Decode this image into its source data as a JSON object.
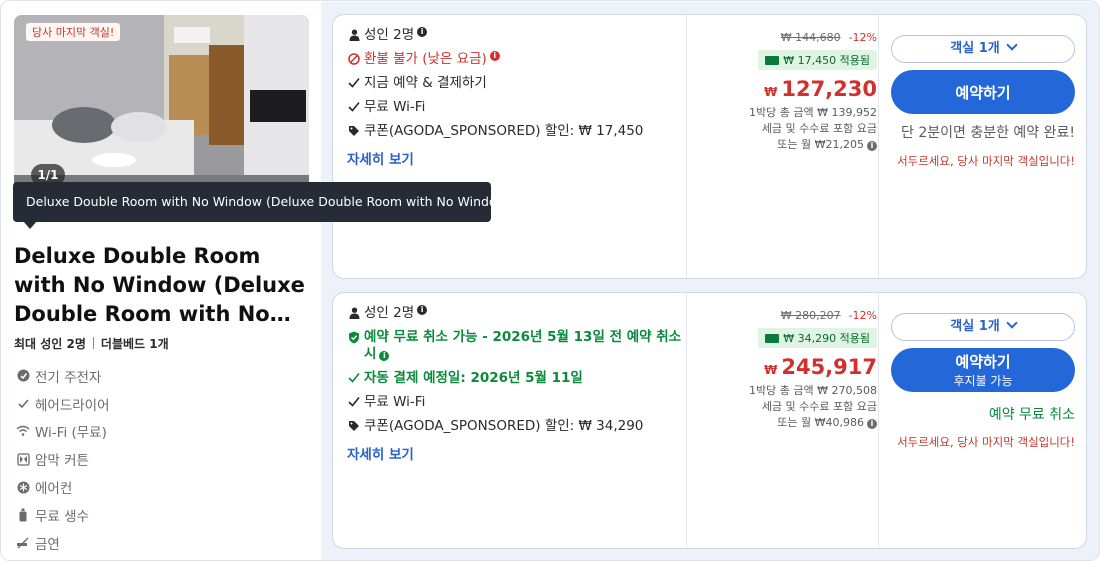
{
  "room": {
    "last_room_tag": "당사 마지막 객실!",
    "photo_counter": "1/1",
    "tooltip": "Deluxe Double Room with No Window (Deluxe Double Room with No Window)",
    "title": "Deluxe Double Room with No Window (Deluxe Double Room with No…",
    "max_adults": "최대 성인 2명",
    "bed": "더블베드 1개",
    "amenities": [
      {
        "icon": "kettle-icon",
        "label": "전기 주전자"
      },
      {
        "icon": "check-icon",
        "label": "헤어드라이어"
      },
      {
        "icon": "wifi-icon",
        "label": "Wi-Fi (무료)"
      },
      {
        "icon": "blackout-curtain-icon",
        "label": "암막 커튼"
      },
      {
        "icon": "snowflake-icon",
        "label": "에어컨"
      },
      {
        "icon": "water-bottle-icon",
        "label": "무료 생수"
      },
      {
        "icon": "no-smoking-icon",
        "label": "금연"
      }
    ]
  },
  "offers": [
    {
      "guests": "성인 2명",
      "policy": "환불 불가 (낮은 요금)",
      "pay_now": "지금 예약 & 결제하기",
      "wifi": "무료 Wi-Fi",
      "coupon": "쿠폰(AGODA_SPONSORED) 할인: ₩ 17,450",
      "details": "자세히 보기",
      "original_price": "₩ 144,680",
      "discount_pct": "-12%",
      "coupon_applied": "₩ 17,450 적용됨",
      "currency": "₩",
      "final_price": "127,230",
      "per_night_total": "1박당 총 금액 ₩ 139,952",
      "tax_note": "세금 및 수수료 포함 요금",
      "monthly": "또는 월 ₩21,205",
      "qty_label": "객실 1개",
      "book_label": "예약하기",
      "quick_note": "단 2분이면 충분한 예약 완료!",
      "urgent": "서두르세요, 당사 마지막 객실입니다!"
    },
    {
      "guests": "성인 2명",
      "policy": "예약 무료 취소 가능 - 2026년 5월 13일 전 예약 취소 시",
      "auto_pay": "자동 결제 예정일: 2026년 5월 11일",
      "wifi": "무료 Wi-Fi",
      "coupon": "쿠폰(AGODA_SPONSORED) 할인: ₩ 34,290",
      "details": "자세히 보기",
      "original_price": "₩ 280,207",
      "discount_pct": "-12%",
      "coupon_applied": "₩ 34,290 적용됨",
      "currency": "₩",
      "final_price": "245,917",
      "per_night_total": "1박당 총 금액 ₩ 270,508",
      "tax_note": "세금 및 수수료 포함 요금",
      "monthly": "또는 월 ₩40,986",
      "qty_label": "객실 1개",
      "book_label": "예약하기",
      "book_sub": "후지불 가능",
      "free_cancel": "예약 무료 취소",
      "urgent": "서두르세요, 당사 마지막 객실입니다!"
    }
  ],
  "colors": {
    "accent": "#2467d8",
    "price_red": "#d0312d",
    "free_green": "#0a8a3a"
  }
}
